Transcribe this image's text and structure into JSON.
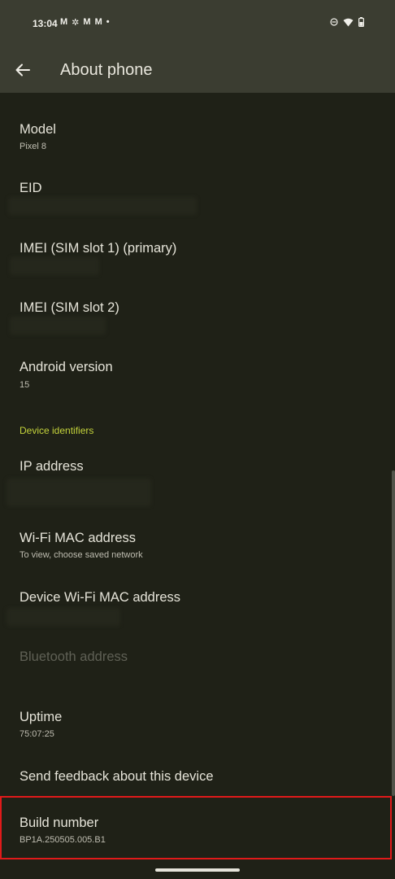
{
  "status_bar": {
    "time": "13:04",
    "notification_icons": [
      "gmail-icon",
      "pinwheel-icon",
      "gmail-icon",
      "gmail-icon",
      "dot-icon"
    ],
    "right_icons": [
      "dnd-icon",
      "wifi-icon",
      "battery-icon"
    ]
  },
  "app_bar": {
    "title": "About phone",
    "back_icon": "arrow-left-icon"
  },
  "items": [
    {
      "title": "Model",
      "summary": "Pixel 8"
    },
    {
      "title": "EID",
      "summary": ""
    },
    {
      "title": "IMEI (SIM slot 1) (primary)",
      "summary": ""
    },
    {
      "title": "IMEI (SIM slot 2)",
      "summary": ""
    },
    {
      "title": "Android version",
      "summary": "15"
    },
    {
      "title": "IP address",
      "summary": ""
    },
    {
      "title": "Wi-Fi MAC address",
      "summary": "To view, choose saved network"
    },
    {
      "title": "Device Wi-Fi MAC address",
      "summary": ""
    },
    {
      "title": "Bluetooth address",
      "summary": ""
    },
    {
      "title": "Uptime",
      "summary": "75:07:25"
    },
    {
      "title": "Send feedback about this device",
      "summary": ""
    },
    {
      "title": "Build number",
      "summary": "BP1A.250505.005.B1"
    }
  ],
  "section": {
    "device_identifiers": "Device identifiers"
  },
  "colors": {
    "background": "#1f2117",
    "app_bar": "#3b3d31",
    "accent": "#c3d23b",
    "highlight": "#e01a1a"
  }
}
